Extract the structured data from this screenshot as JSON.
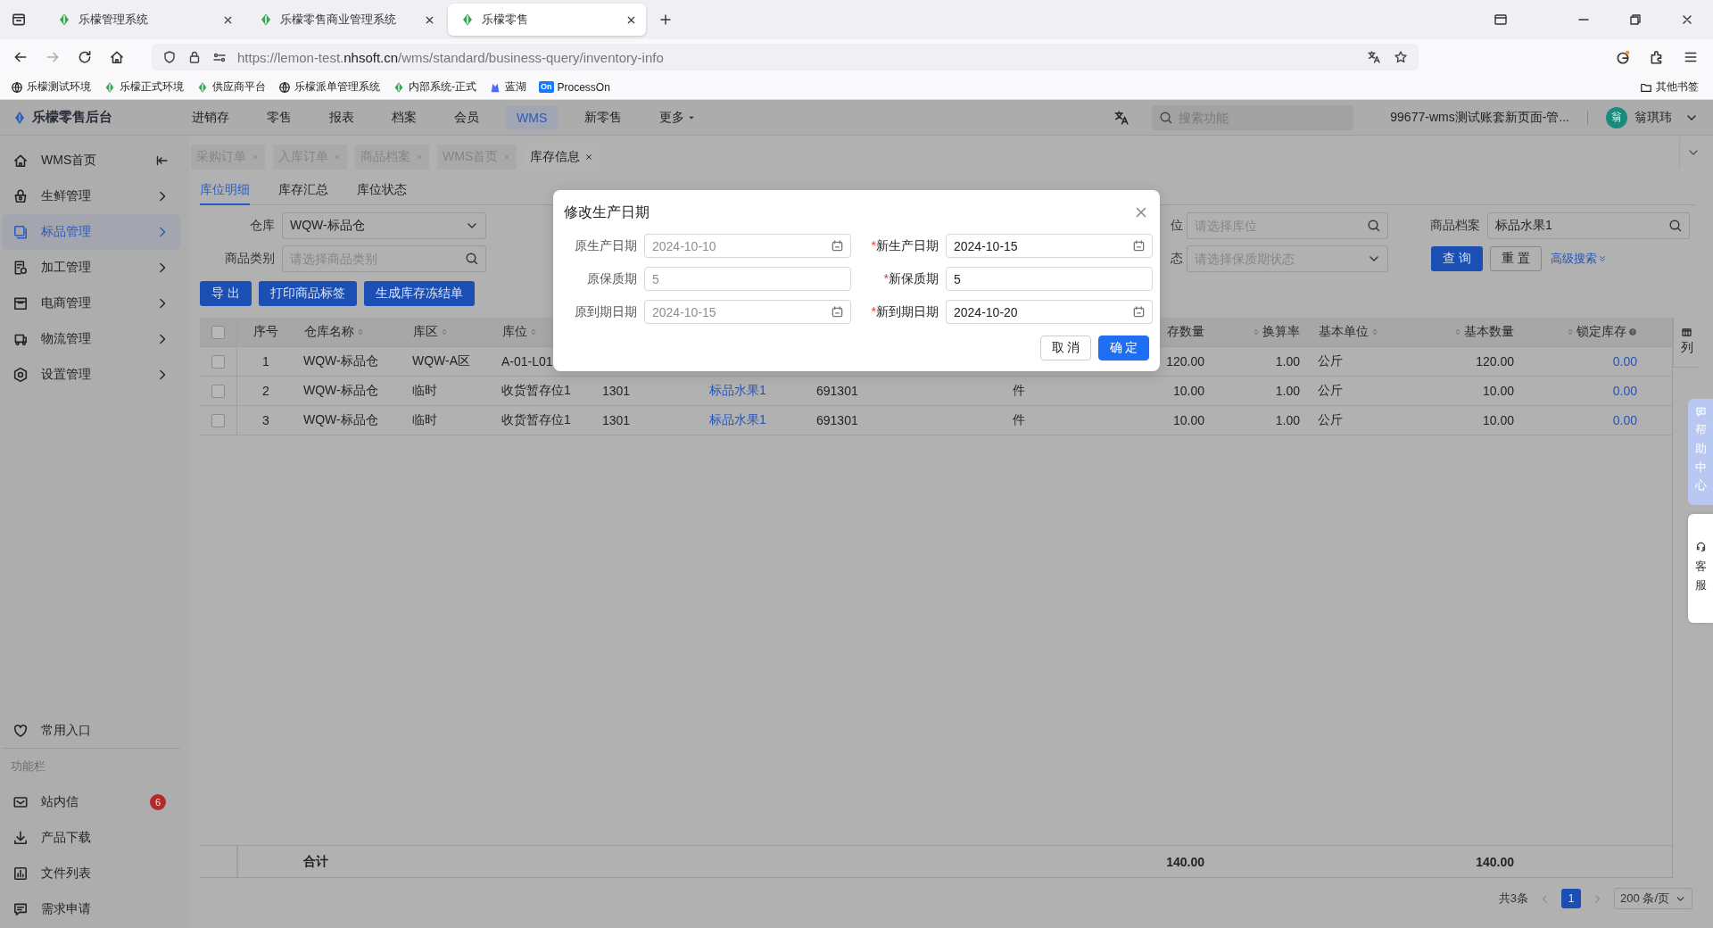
{
  "browser": {
    "tabs": [
      {
        "title": "乐檬管理系统",
        "selected": false
      },
      {
        "title": "乐檬零售商业管理系统",
        "selected": false
      },
      {
        "title": "乐檬零售",
        "selected": true
      }
    ],
    "url": "https://lemon-test.**nhsoft.cn**/wms/standard/business-query/inventory-info",
    "bookmarks": [
      {
        "label": "乐檬测试环境"
      },
      {
        "label": "乐檬正式环境"
      },
      {
        "label": "供应商平台"
      },
      {
        "label": "乐檬派单管理系统"
      },
      {
        "label": "内部系统-正式"
      },
      {
        "label": "蓝湖"
      },
      {
        "label": "ProcessOn",
        "icon_text": "On"
      }
    ],
    "other_bookmarks": "其他书签"
  },
  "app_header": {
    "logo": "乐檬零售后台",
    "nav": [
      {
        "label": "进销存",
        "selected": false
      },
      {
        "label": "零售",
        "selected": false
      },
      {
        "label": "报表",
        "selected": false
      },
      {
        "label": "档案",
        "selected": false
      },
      {
        "label": "会员",
        "selected": false
      },
      {
        "label": "WMS",
        "selected": true
      },
      {
        "label": "新零售",
        "selected": false
      },
      {
        "label": "更多",
        "selected": false,
        "dropdown": true
      }
    ],
    "search_placeholder": "搜索功能",
    "account": "99677-wms测试账套新页面-管...",
    "avatar_text": "翁",
    "user": "翁琪玮"
  },
  "sidebar": {
    "items": [
      {
        "label": "WMS首页",
        "selected": false
      },
      {
        "label": "生鲜管理",
        "selected": false
      },
      {
        "label": "标品管理",
        "selected": true
      },
      {
        "label": "加工管理",
        "selected": false
      },
      {
        "label": "电商管理",
        "selected": false
      },
      {
        "label": "物流管理",
        "selected": false
      },
      {
        "label": "设置管理",
        "selected": false
      }
    ],
    "favorites": "常用入口",
    "section_title": "功能栏",
    "tools": [
      {
        "label": "站内信",
        "badge": "6"
      },
      {
        "label": "产品下载"
      },
      {
        "label": "文件列表"
      },
      {
        "label": "需求申请"
      }
    ]
  },
  "page_tabs": [
    {
      "label": "采购订单",
      "selected": false
    },
    {
      "label": "入库订单",
      "selected": false
    },
    {
      "label": "商品档案",
      "selected": false
    },
    {
      "label": "WMS首页",
      "selected": false
    },
    {
      "label": "库存信息",
      "selected": true
    }
  ],
  "sub_tabs": [
    {
      "label": "库位明细",
      "selected": true
    },
    {
      "label": "库存汇总",
      "selected": false
    },
    {
      "label": "库位状态",
      "selected": false
    }
  ],
  "filters": {
    "left": [
      {
        "label": "仓库",
        "value": "WQW-标品仓"
      },
      {
        "label": "商品类别",
        "placeholder": "请选择商品类别"
      }
    ],
    "middle": [
      {
        "label": "位",
        "placeholder": "请选择库位"
      },
      {
        "label": "态",
        "placeholder": "请选择保质期状态"
      }
    ],
    "right": [
      {
        "label": "商品档案",
        "value": "标品水果1"
      }
    ],
    "query": "查 询",
    "reset": "重 置",
    "advanced": "高级搜索"
  },
  "actions": [
    "导 出",
    "打印商品标签",
    "生成库存冻结单"
  ],
  "table": {
    "all_checked": false,
    "columns": [
      {
        "label": "序号",
        "sortable": false
      },
      {
        "label": "仓库名称",
        "sortable": true
      },
      {
        "label": "库区",
        "sortable": true
      },
      {
        "label": "库位",
        "sortable": true
      },
      {},
      {
        "kind": "link"
      },
      {},
      {},
      {
        "label": "存数量",
        "sortable": false
      },
      {
        "label": "换算率",
        "sortable": true
      },
      {
        "label": "基本单位",
        "sortable": true
      },
      {
        "label": "基本数量",
        "sortable": true
      },
      {
        "label": "锁定库存",
        "sortable": true,
        "help": true,
        "kind": "link"
      }
    ],
    "rows": [
      {
        "checked": false,
        "cells": [
          "1",
          "WQW-标品仓",
          "WQW-A区",
          "A-01-L01",
          null,
          null,
          null,
          null,
          "120.00",
          "1.00",
          "公斤",
          "120.00",
          "0.00"
        ]
      },
      {
        "checked": false,
        "cells": [
          "2",
          "WQW-标品仓",
          "临时",
          "收货暂存位1",
          "1301",
          "标品水果1",
          "691301",
          "件",
          "10.00",
          "1.00",
          "公斤",
          "10.00",
          "0.00"
        ]
      },
      {
        "checked": false,
        "cells": [
          "3",
          "WQW-标品仓",
          "临时",
          "收货暂存位1",
          "1301",
          "标品水果1",
          "691301",
          "件",
          "10.00",
          "1.00",
          "公斤",
          "10.00",
          "0.00"
        ]
      }
    ],
    "totals": {
      "label": "合计",
      "stock_quantity": "140.00",
      "base_quantity": "140.00"
    },
    "column_settings": "列"
  },
  "pagination": {
    "total": "共3条",
    "pages": [
      {
        "label": "1",
        "selected": true
      }
    ],
    "page_size": "200 条/页"
  },
  "dialog": {
    "title": "修改生产日期",
    "fields": [
      {
        "label": "原生产日期",
        "value": "2024-10-10",
        "disabled": true
      },
      {
        "label": "新生产日期",
        "required_mark": "*",
        "value": "2024-10-15",
        "disabled": false
      },
      {
        "label": "原保质期",
        "value": "5",
        "disabled": true
      },
      {
        "label": "新保质期",
        "required_mark": "*",
        "value": "5",
        "disabled": false
      },
      {
        "label": "原到期日期",
        "value": "2024-10-15",
        "disabled": true
      },
      {
        "label": "新到期日期",
        "required_mark": "*",
        "value": "2024-10-20",
        "disabled": false
      }
    ],
    "buttons": [
      {
        "label": "取 消",
        "kind": "default"
      },
      {
        "label": "确 定",
        "kind": "primary"
      }
    ]
  },
  "float": {
    "help": "帮助中心",
    "service": "客服"
  }
}
